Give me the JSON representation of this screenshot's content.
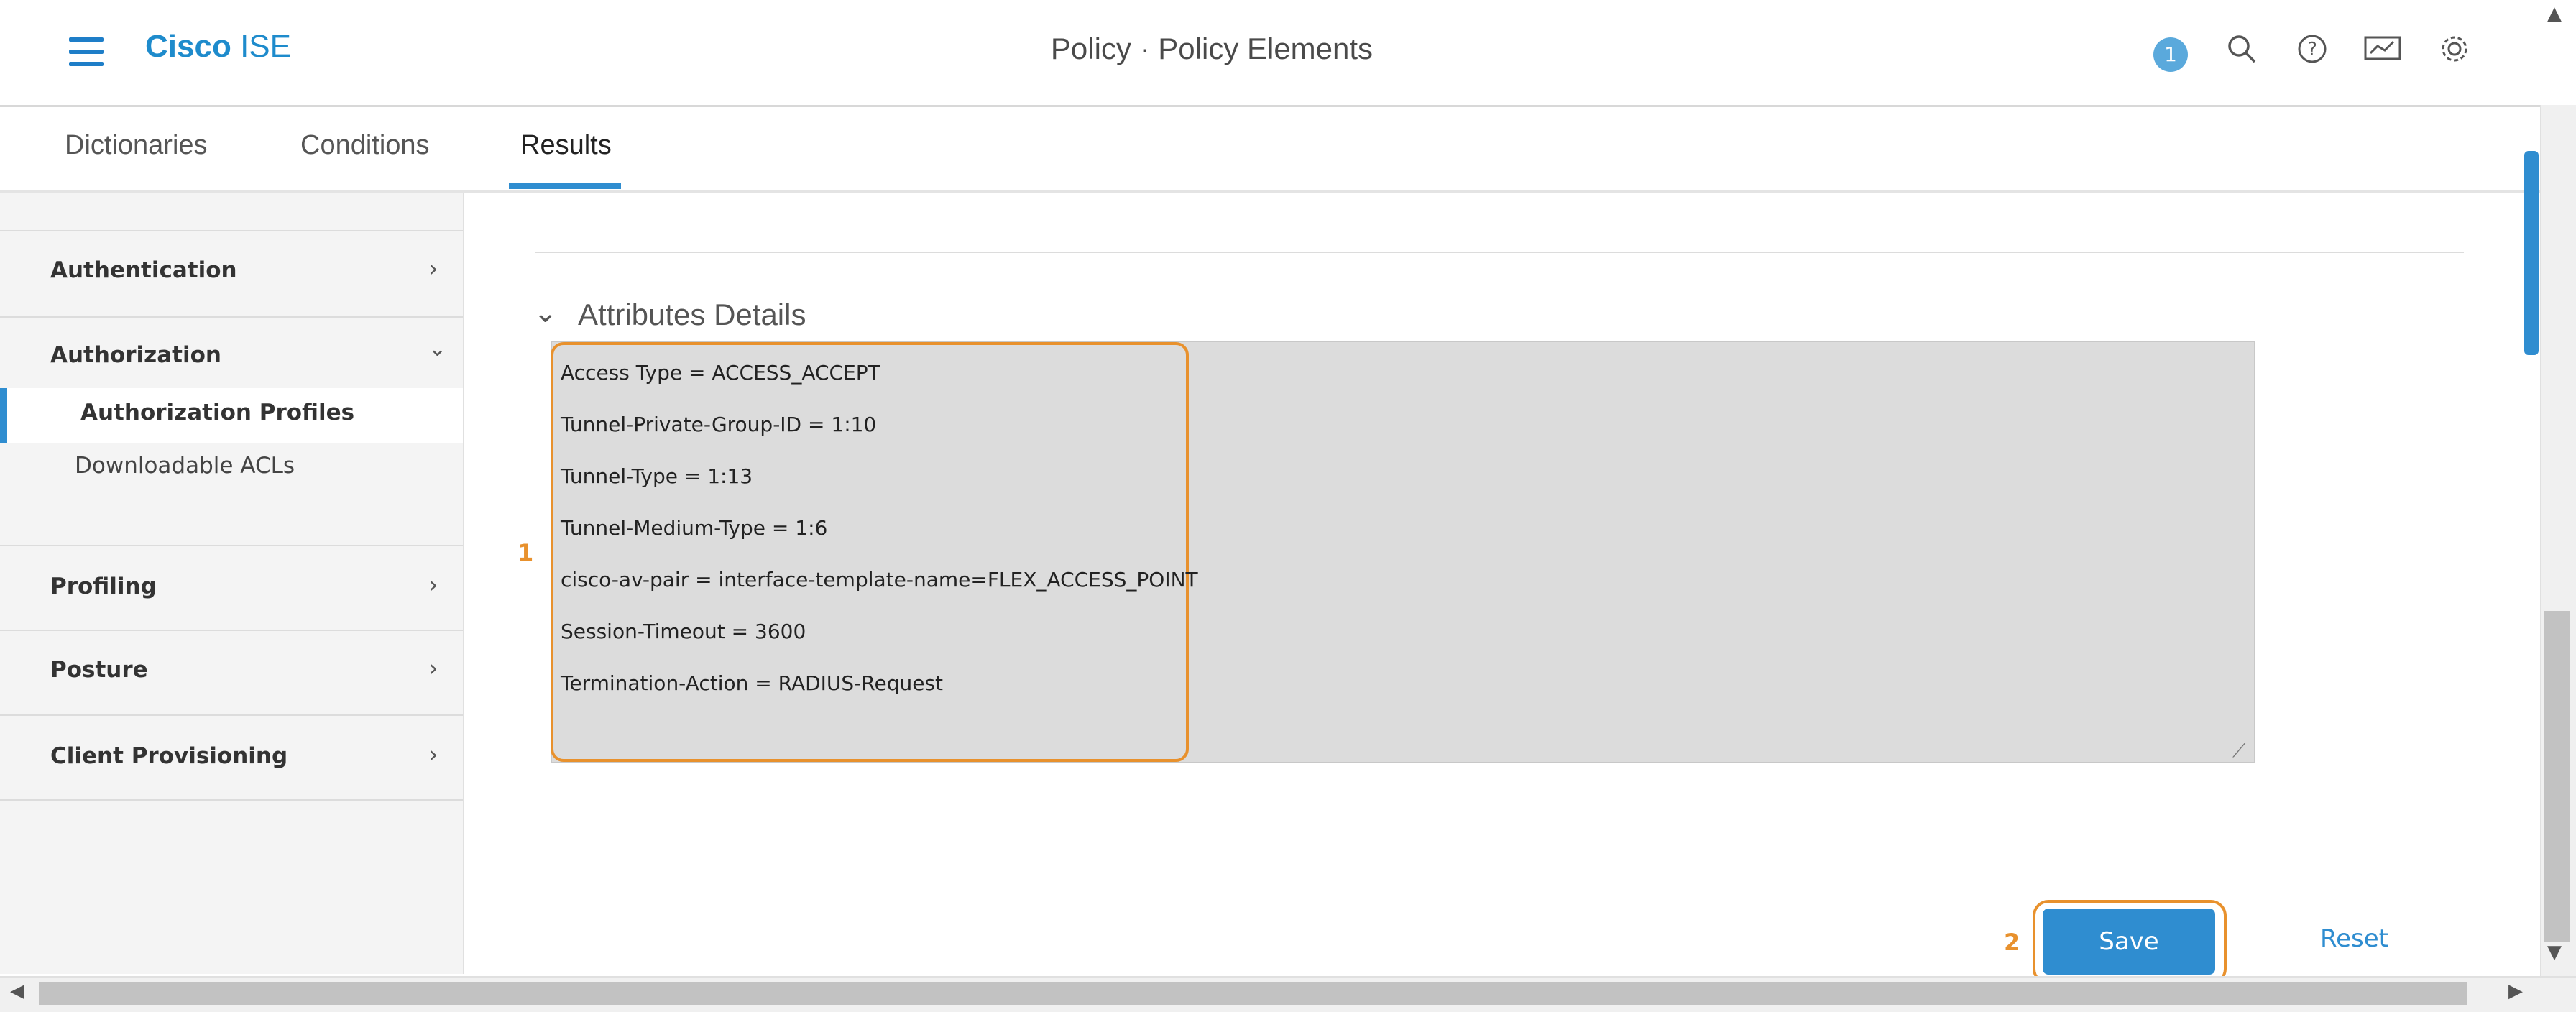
{
  "header": {
    "brand_bold": "Cisco",
    "brand_rest": "ISE",
    "title": "Policy · Policy Elements",
    "notification_count": "1",
    "icons": [
      "menu-icon",
      "search-icon",
      "help-icon",
      "monitor-icon",
      "gear-icon"
    ]
  },
  "tabs": [
    {
      "label": "Dictionaries",
      "active": false
    },
    {
      "label": "Conditions",
      "active": false
    },
    {
      "label": "Results",
      "active": true
    }
  ],
  "sidebar": {
    "items": [
      {
        "label": "Authentication",
        "expanded": false
      },
      {
        "label": "Authorization",
        "expanded": true,
        "children": [
          {
            "label": "Authorization Profiles",
            "selected": true
          },
          {
            "label": "Downloadable ACLs",
            "selected": false
          }
        ]
      },
      {
        "label": "Profiling",
        "expanded": false
      },
      {
        "label": "Posture",
        "expanded": false
      },
      {
        "label": "Client Provisioning",
        "expanded": false
      }
    ]
  },
  "main": {
    "section_title": "Attributes Details",
    "attributes": [
      "Access Type = ACCESS_ACCEPT",
      "Tunnel-Private-Group-ID = 1:10",
      "Tunnel-Type = 1:13",
      "Tunnel-Medium-Type = 1:6",
      "cisco-av-pair = interface-template-name=FLEX_ACCESS_POINT",
      "Session-Timeout = 3600",
      "Termination-Action = RADIUS-Request"
    ],
    "callout_1": "1",
    "callout_2": "2",
    "save_label": "Save",
    "reset_label": "Reset"
  },
  "colors": {
    "accent": "#2f8dd0",
    "highlight": "#e8912d",
    "attr_bg": "#dcdcdc"
  }
}
